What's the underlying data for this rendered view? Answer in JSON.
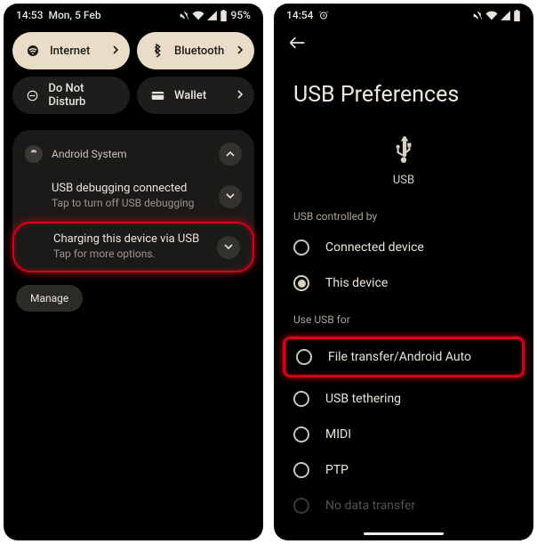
{
  "left": {
    "status": {
      "time": "14:53",
      "date": "Mon, 5 Feb",
      "battery": "95%"
    },
    "qs": {
      "internet": "Internet",
      "bluetooth": "Bluetooth",
      "dnd": "Do Not Disturb",
      "wallet": "Wallet"
    },
    "notif": {
      "app": "Android System",
      "n1_title": "USB debugging connected",
      "n1_sub": "Tap to turn off USB debugging",
      "n2_title": "Charging this device via USB",
      "n2_sub": "Tap for more options."
    },
    "manage": "Manage"
  },
  "right": {
    "status": {
      "time": "14:54"
    },
    "title": "USB Preferences",
    "hero_label": "USB",
    "section_controlled": "USB controlled by",
    "opt_connected": "Connected device",
    "opt_this": "This device",
    "section_usefor": "Use USB for",
    "opt_file": "File transfer/Android Auto",
    "opt_tether": "USB tethering",
    "opt_midi": "MIDI",
    "opt_ptp": "PTP",
    "opt_nodata": "No data transfer"
  }
}
